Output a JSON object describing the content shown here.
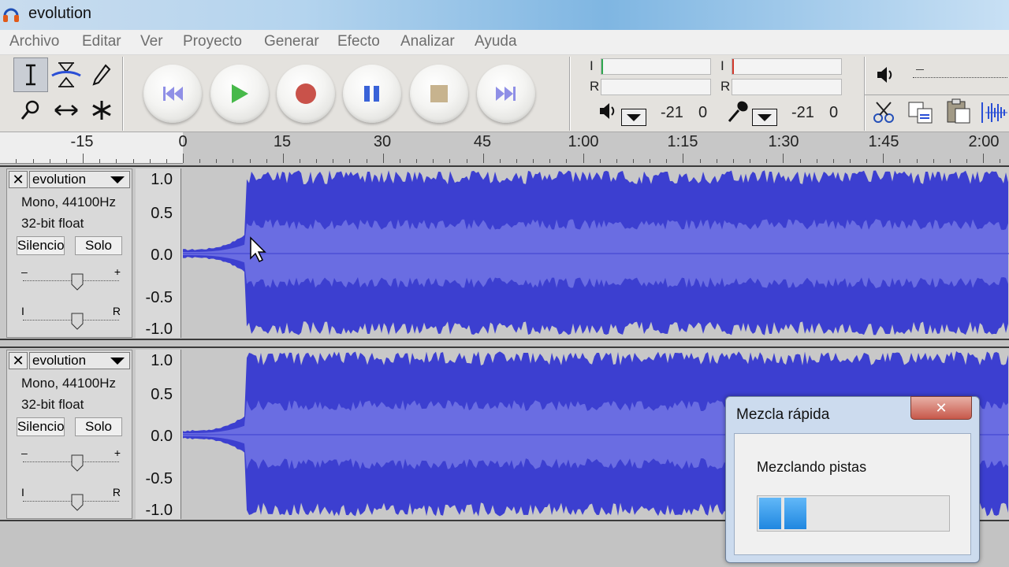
{
  "window": {
    "title": "evolution"
  },
  "menu": [
    "Archivo",
    "Editar",
    "Ver",
    "Proyecto",
    "Generar",
    "Efecto",
    "Analizar",
    "Ayuda"
  ],
  "tools": {
    "names": [
      "selection-tool",
      "envelope-tool",
      "draw-tool",
      "zoom-tool",
      "timeshift-tool",
      "multi-tool"
    ],
    "selected": "selection-tool"
  },
  "transport": [
    "skip-to-start",
    "play",
    "record",
    "pause",
    "stop",
    "skip-to-end"
  ],
  "meters": {
    "l_label": "I",
    "r_label": "R",
    "output_db": "-21",
    "output_zero": "0",
    "input_l_label": "I",
    "input_r_label": "R",
    "input_db": "-21",
    "input_zero": "0"
  },
  "ruler": {
    "labels": [
      "-15",
      "0",
      "15",
      "30",
      "45",
      "1:00",
      "1:15",
      "1:30",
      "1:45",
      "2:00"
    ]
  },
  "tracks": [
    {
      "name": "evolution",
      "close_label": "✕",
      "format": "Mono, 44100Hz",
      "bitdepth": "32-bit float",
      "mute_label": "Silencio",
      "solo_label": "Solo",
      "gain_minus": "–",
      "gain_plus": "+",
      "pan_left": "I",
      "pan_right": "R",
      "scale": [
        "1.0",
        "0.5",
        "0.0",
        "-0.5",
        "-1.0"
      ]
    },
    {
      "name": "evolution",
      "close_label": "✕",
      "format": "Mono, 44100Hz",
      "bitdepth": "32-bit float",
      "mute_label": "Silencio",
      "solo_label": "Solo",
      "gain_minus": "–",
      "gain_plus": "+",
      "pan_left": "I",
      "pan_right": "R",
      "scale": [
        "1.0",
        "0.5",
        "0.0",
        "-0.5",
        "-1.0"
      ]
    }
  ],
  "dialog": {
    "title": "Mezcla rápida",
    "close_label": "✕",
    "message": "Mezclando pistas",
    "progress": 0.25
  },
  "colors": {
    "wave": "#3c3fd0",
    "wave_rms": "#6a6de2"
  }
}
